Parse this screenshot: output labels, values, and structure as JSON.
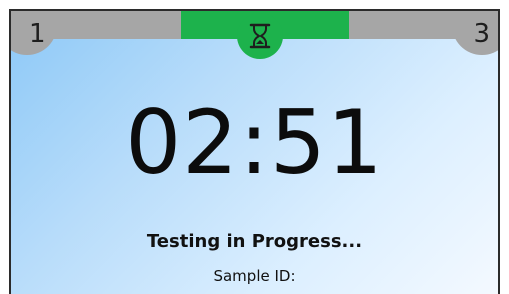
{
  "header": {
    "step_left": "1",
    "step_right": "3",
    "current_step_icon": "hourglass-icon"
  },
  "main": {
    "timer": "02:51",
    "status": "Testing in Progress...",
    "sample_id_label": "Sample ID:"
  },
  "colors": {
    "accent": "#1db24c",
    "inactive_step": "#a6a6a6",
    "background_light": "#f4f9ff",
    "background_blue": "#8cc8f7"
  }
}
